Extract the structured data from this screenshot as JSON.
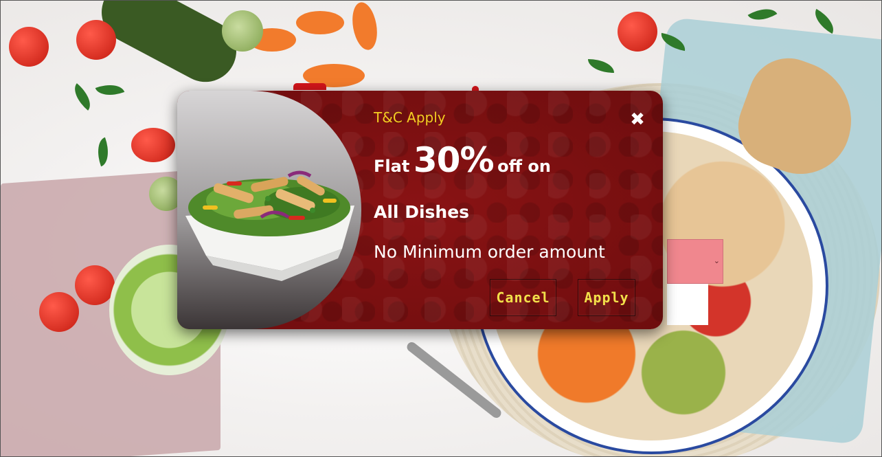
{
  "offer_popup": {
    "tc_label": "T&C Apply",
    "close_glyph": "✖",
    "flat_prefix": "Flat",
    "discount": "30%",
    "off_on": "off on",
    "scope": "All Dishes",
    "min_order_text": "No Minimum order amount",
    "cancel_label": "Cancel",
    "apply_label": "Apply"
  },
  "colors": {
    "modal_background": "#7a0f10",
    "tc_text": "#f2cf22",
    "button_text": "#f2e04a",
    "body_text": "#ffffff"
  },
  "icons": {
    "close": "close-icon",
    "dropdown": "chevron-down-icon"
  }
}
